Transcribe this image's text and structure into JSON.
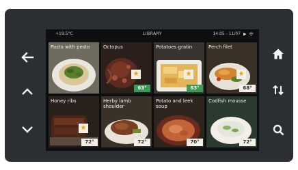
{
  "status": {
    "left": "+19.5°C",
    "title": "LIBRARY",
    "right": "14:05 - 11/07"
  },
  "nav": {
    "left": [
      "back-arrow-icon",
      "chevron-up-icon",
      "chevron-down-icon"
    ],
    "right": [
      "home-icon",
      "sort-icon",
      "search-icon"
    ]
  },
  "colors": {
    "panel": "#2b2f33",
    "screen": "#0d0e0f",
    "star": "#f2a400",
    "temp_green": "#3e9a57"
  },
  "recipes": [
    {
      "label": "Pasta with pesto",
      "temp": "",
      "star": false,
      "temp_green": false
    },
    {
      "label": "Octopus",
      "temp": "63°",
      "star": true,
      "temp_green": true
    },
    {
      "label": "Potatoes gratin",
      "temp": "63°",
      "star": true,
      "temp_green": true
    },
    {
      "label": "Perch filet",
      "temp": "68°",
      "star": true,
      "temp_green": false
    },
    {
      "label": "Honey ribs",
      "temp": "72°",
      "star": true,
      "temp_green": false
    },
    {
      "label": "Herby lamb shoulder",
      "temp": "72°",
      "star": false,
      "temp_green": false
    },
    {
      "label": "Potato and leek soup",
      "temp": "70°",
      "star": false,
      "temp_green": false
    },
    {
      "label": "Codfish mousse",
      "temp": "72°",
      "star": false,
      "temp_green": false
    }
  ]
}
